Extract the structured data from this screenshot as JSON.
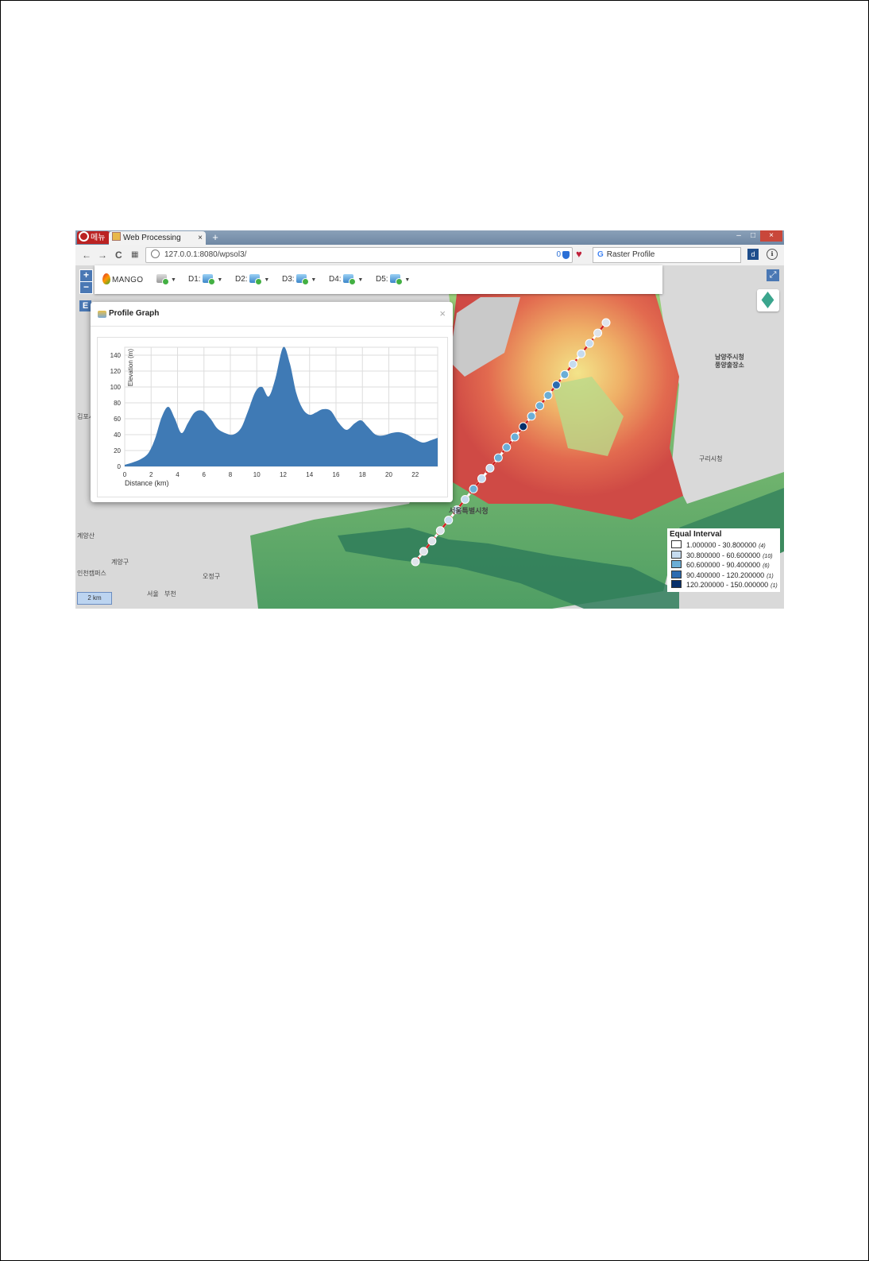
{
  "browser": {
    "menu_label": "메뉴",
    "tab_title": "Web Processing Services",
    "tab_close": "×",
    "new_tab": "+",
    "url": "127.0.0.1:8080/wpsol3/",
    "counter": "0",
    "search_value": "Raster Profile",
    "search_engine": "G",
    "nav": {
      "back": "←",
      "forward": "→",
      "reload": "C",
      "speed_dial": "▦"
    },
    "window_controls": {
      "minimize": "–",
      "maximize": "□",
      "close": "×"
    },
    "ext_label": "ℹ"
  },
  "toolbar": {
    "logo": "MANGO",
    "tools": [
      {
        "label": ""
      },
      {
        "label": "D1:"
      },
      {
        "label": "D2:"
      },
      {
        "label": "D3:"
      },
      {
        "label": "D4:"
      },
      {
        "label": "D5:"
      }
    ]
  },
  "map_controls": {
    "zoom_in": "+",
    "zoom_out": "−",
    "e_label": "E",
    "fullscreen": "⤢",
    "scale": "2 km"
  },
  "map_labels": [
    "김포시",
    "계양산",
    "계양구",
    "인천캠퍼스",
    "서울특별시청",
    "구리시청",
    "남양주시청",
    "풍양출장소",
    "오정구",
    "서울",
    "부천"
  ],
  "popup": {
    "title": "Profile Graph",
    "close": "×"
  },
  "chart_data": {
    "type": "area",
    "xlabel": "Distance (km)",
    "ylabel": "Elevation (m)",
    "xlim": [
      0,
      23.7
    ],
    "ylim": [
      0,
      150
    ],
    "xticks": [
      "0",
      "2",
      "4",
      "6",
      "8",
      "10",
      "12",
      "14",
      "16",
      "18",
      "20",
      "22"
    ],
    "yticks": [
      "0",
      "20",
      "40",
      "60",
      "80",
      "100",
      "120",
      "140"
    ],
    "grid": true,
    "color": "#3f7ab5",
    "x": [
      0,
      0.6,
      1.2,
      1.8,
      2.3,
      2.8,
      3.3,
      3.8,
      4.3,
      4.8,
      5.3,
      5.9,
      6.5,
      7.0,
      7.6,
      8.2,
      8.8,
      9.3,
      9.9,
      10.4,
      10.9,
      11.4,
      12.0,
      12.5,
      13.0,
      13.5,
      14.0,
      14.5,
      15.0,
      15.6,
      16.2,
      16.8,
      17.4,
      17.9,
      18.4,
      19.0,
      19.6,
      20.2,
      20.8,
      21.4,
      22.0,
      22.6,
      23.2,
      23.7
    ],
    "y": [
      2,
      5,
      9,
      17,
      35,
      62,
      75,
      60,
      42,
      55,
      68,
      70,
      60,
      48,
      42,
      40,
      48,
      68,
      94,
      100,
      88,
      110,
      150,
      130,
      92,
      72,
      65,
      68,
      72,
      70,
      55,
      46,
      54,
      58,
      50,
      40,
      39,
      42,
      43,
      40,
      34,
      30,
      33,
      36
    ]
  },
  "legend": {
    "title": "Equal Interval",
    "classes": [
      {
        "label": "1.000000 - 30.800000",
        "count": "(4)",
        "color": "#ffffff"
      },
      {
        "label": "30.800000 - 60.600000",
        "count": "(10)",
        "color": "#c6dbef"
      },
      {
        "label": "60.600000 - 90.400000",
        "count": "(6)",
        "color": "#6baed6"
      },
      {
        "label": "90.400000 - 120.200000",
        "count": "(1)",
        "color": "#2c6bb0"
      },
      {
        "label": "120.200000 - 150.000000",
        "count": "(1)",
        "color": "#08306b"
      }
    ]
  },
  "profile_points": [
    {
      "class": 1
    },
    {
      "class": 1
    },
    {
      "class": 1
    },
    {
      "class": 1
    },
    {
      "class": 2
    },
    {
      "class": 2
    },
    {
      "class": 2
    },
    {
      "class": 3
    },
    {
      "class": 2
    },
    {
      "class": 2
    },
    {
      "class": 3
    },
    {
      "class": 3
    },
    {
      "class": 3
    },
    {
      "class": 5
    },
    {
      "class": 3
    },
    {
      "class": 3
    },
    {
      "class": 3
    },
    {
      "class": 4
    },
    {
      "class": 3
    },
    {
      "class": 2
    },
    {
      "class": 2
    },
    {
      "class": 2
    },
    {
      "class": 1
    },
    {
      "class": 1
    }
  ]
}
